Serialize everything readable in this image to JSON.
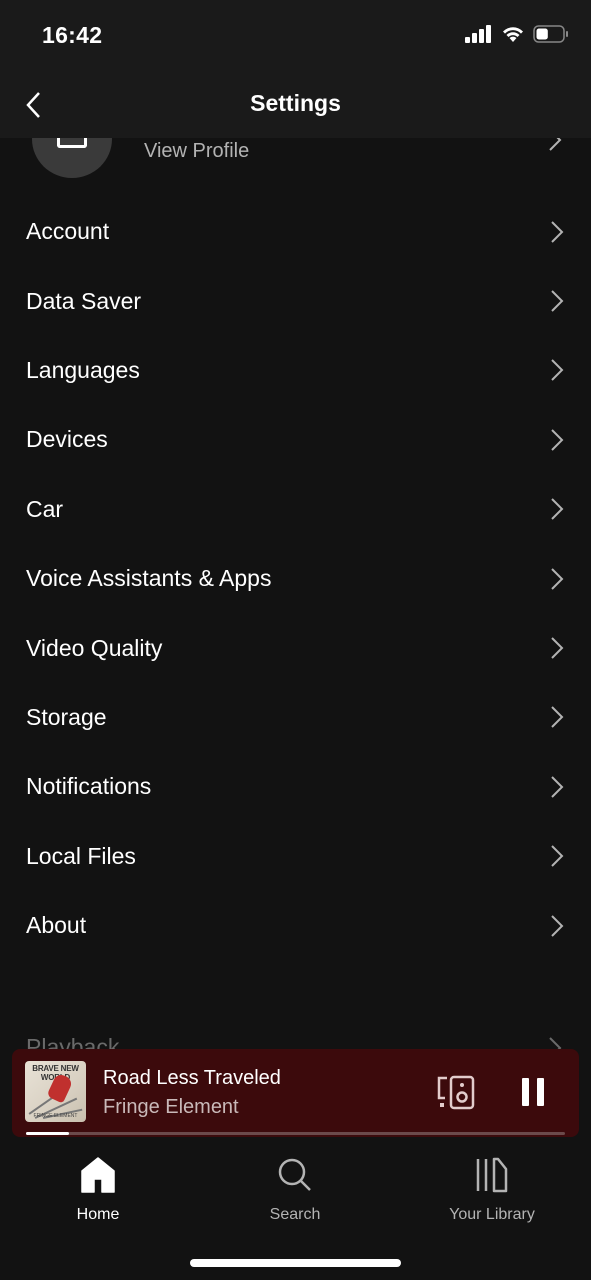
{
  "status_bar": {
    "time": "16:42",
    "battery_level": 0.45
  },
  "header": {
    "title": "Settings",
    "back_icon": "chevron-left-icon"
  },
  "profile": {
    "link_label": "View Profile"
  },
  "settings": {
    "items": [
      {
        "label": "Account"
      },
      {
        "label": "Data Saver"
      },
      {
        "label": "Languages"
      },
      {
        "label": "Devices"
      },
      {
        "label": "Car"
      },
      {
        "label": "Voice Assistants & Apps"
      },
      {
        "label": "Video Quality"
      },
      {
        "label": "Storage"
      },
      {
        "label": "Notifications"
      },
      {
        "label": "Local Files"
      },
      {
        "label": "About"
      }
    ],
    "partially_hidden_item": "Playback"
  },
  "now_playing": {
    "track": "Road Less Traveled",
    "artist": "Fringe Element",
    "album_art_title": "BRAVE NEW WORLD",
    "album_art_subtitle": "FRINGE ELEMENT",
    "progress_percent": 8,
    "background_color": "#3c0a0c",
    "state": "playing"
  },
  "tab_bar": {
    "tabs": [
      {
        "label": "Home",
        "icon": "home-icon",
        "active": true
      },
      {
        "label": "Search",
        "icon": "search-icon",
        "active": false
      },
      {
        "label": "Your Library",
        "icon": "library-icon",
        "active": false
      }
    ]
  }
}
